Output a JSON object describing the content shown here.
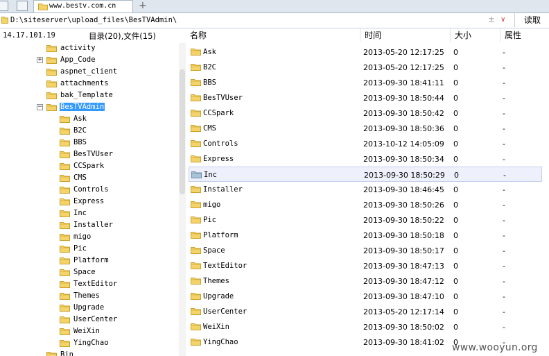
{
  "tab": {
    "title": "www.bestv.com.cn",
    "new_tab": "+"
  },
  "pathbar": {
    "path": "D:\\siteserver\\upload_files\\BesTVAdmin\\",
    "plus": "±",
    "dropdown": "∨",
    "read_label": "读取"
  },
  "left": {
    "ip": "14.17.101.19",
    "counts": "目录(20),文件(15)",
    "tree": [
      {
        "label": "activity",
        "level": 1,
        "expander": ""
      },
      {
        "label": "App_Code",
        "level": 1,
        "expander": "+"
      },
      {
        "label": "aspnet_client",
        "level": 1,
        "expander": ""
      },
      {
        "label": "attachments",
        "level": 1,
        "expander": ""
      },
      {
        "label": "bak_Template",
        "level": 1,
        "expander": ""
      },
      {
        "label": "BesTVAdmin",
        "level": 1,
        "expander": "−",
        "selected": true,
        "open": true
      },
      {
        "label": "Ask",
        "level": 2,
        "expander": ""
      },
      {
        "label": "B2C",
        "level": 2,
        "expander": ""
      },
      {
        "label": "BBS",
        "level": 2,
        "expander": ""
      },
      {
        "label": "BesTVUser",
        "level": 2,
        "expander": ""
      },
      {
        "label": "CCSpark",
        "level": 2,
        "expander": ""
      },
      {
        "label": "CMS",
        "level": 2,
        "expander": ""
      },
      {
        "label": "Controls",
        "level": 2,
        "expander": ""
      },
      {
        "label": "Express",
        "level": 2,
        "expander": ""
      },
      {
        "label": "Inc",
        "level": 2,
        "expander": ""
      },
      {
        "label": "Installer",
        "level": 2,
        "expander": ""
      },
      {
        "label": "migo",
        "level": 2,
        "expander": ""
      },
      {
        "label": "Pic",
        "level": 2,
        "expander": ""
      },
      {
        "label": "Platform",
        "level": 2,
        "expander": ""
      },
      {
        "label": "Space",
        "level": 2,
        "expander": ""
      },
      {
        "label": "TextEditor",
        "level": 2,
        "expander": ""
      },
      {
        "label": "Themes",
        "level": 2,
        "expander": ""
      },
      {
        "label": "Upgrade",
        "level": 2,
        "expander": ""
      },
      {
        "label": "UserCenter",
        "level": 2,
        "expander": ""
      },
      {
        "label": "WeiXin",
        "level": 2,
        "expander": ""
      },
      {
        "label": "YingChao",
        "level": 2,
        "expander": ""
      },
      {
        "label": "Bin",
        "level": 1,
        "expander": ""
      }
    ]
  },
  "columns": {
    "name": "名称",
    "time": "时间",
    "size": "大小",
    "attr": "属性"
  },
  "files": [
    {
      "name": "Ask",
      "time": "2013-05-20 12:17:25",
      "size": "0",
      "attr": "-"
    },
    {
      "name": "B2C",
      "time": "2013-05-20 12:17:25",
      "size": "0",
      "attr": "-"
    },
    {
      "name": "BBS",
      "time": "2013-09-30 18:41:11",
      "size": "0",
      "attr": "-"
    },
    {
      "name": "BesTVUser",
      "time": "2013-09-30 18:50:44",
      "size": "0",
      "attr": "-"
    },
    {
      "name": "CCSpark",
      "time": "2013-09-30 18:50:42",
      "size": "0",
      "attr": "-"
    },
    {
      "name": "CMS",
      "time": "2013-09-30 18:50:36",
      "size": "0",
      "attr": "-"
    },
    {
      "name": "Controls",
      "time": "2013-10-12 14:05:09",
      "size": "0",
      "attr": "-"
    },
    {
      "name": "Express",
      "time": "2013-09-30 18:50:34",
      "size": "0",
      "attr": "-"
    },
    {
      "name": "Inc",
      "time": "2013-09-30 18:50:29",
      "size": "0",
      "attr": "-",
      "highlight": true
    },
    {
      "name": "Installer",
      "time": "2013-09-30 18:46:45",
      "size": "0",
      "attr": "-"
    },
    {
      "name": "migo",
      "time": "2013-09-30 18:50:26",
      "size": "0",
      "attr": "-"
    },
    {
      "name": "Pic",
      "time": "2013-09-30 18:50:22",
      "size": "0",
      "attr": "-"
    },
    {
      "name": "Platform",
      "time": "2013-09-30 18:50:18",
      "size": "0",
      "attr": "-"
    },
    {
      "name": "Space",
      "time": "2013-09-30 18:50:17",
      "size": "0",
      "attr": "-"
    },
    {
      "name": "TextEditor",
      "time": "2013-09-30 18:47:13",
      "size": "0",
      "attr": "-"
    },
    {
      "name": "Themes",
      "time": "2013-09-30 18:47:12",
      "size": "0",
      "attr": "-"
    },
    {
      "name": "Upgrade",
      "time": "2013-09-30 18:47:10",
      "size": "0",
      "attr": "-"
    },
    {
      "name": "UserCenter",
      "time": "2013-05-20 12:17:14",
      "size": "0",
      "attr": "-"
    },
    {
      "name": "WeiXin",
      "time": "2013-09-30 18:50:02",
      "size": "0",
      "attr": "-"
    },
    {
      "name": "YingChao",
      "time": "2013-09-30 18:41:02",
      "size": "0",
      "attr": "-"
    }
  ],
  "icons": {
    "folder": "folder-icon",
    "folder_open": "folder-open-icon",
    "folder_selected": "folder-highlighted-icon"
  },
  "colors": {
    "folder": "#f5d36b",
    "folder_edge": "#c9a227",
    "selection": "#3399ff",
    "row_highlight": "#eef0fb"
  },
  "watermark": "www.wooyun.org"
}
